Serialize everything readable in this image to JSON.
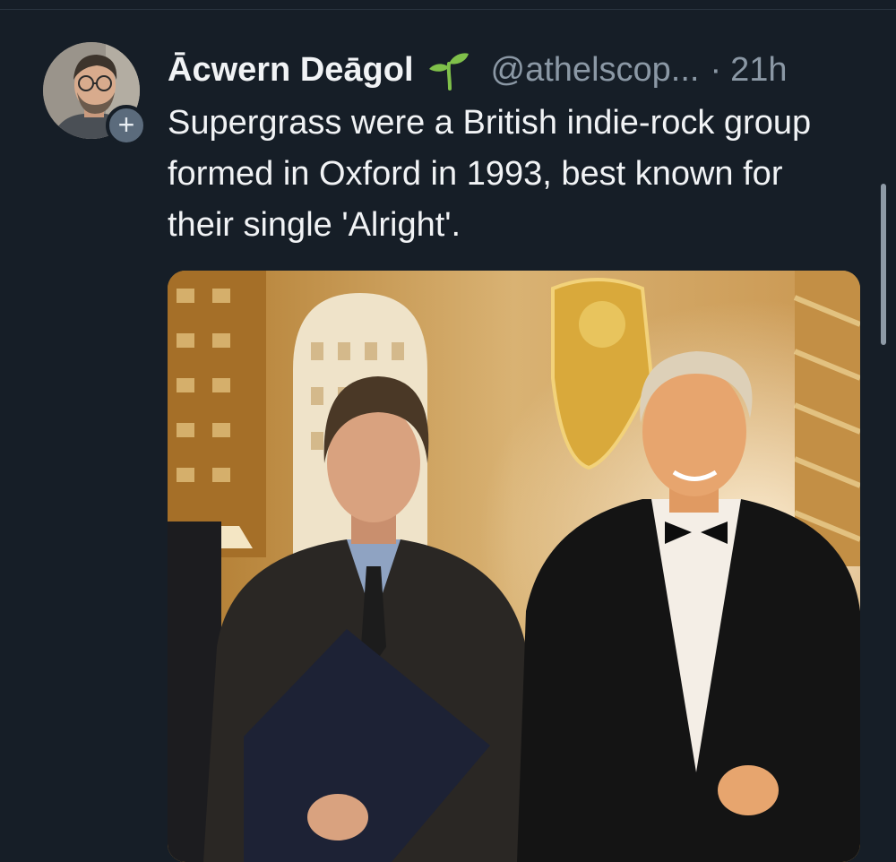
{
  "post": {
    "author": {
      "display_name": "Ācwern Deāgol",
      "handle": "@athelscop...",
      "name_badge_icon": "sprout-icon",
      "follow_icon": "plus-icon",
      "follow_symbol": "+"
    },
    "separator": "·",
    "timestamp": "21h",
    "text": "Supergrass were a British indie-rock group formed in Oxford in 1993, best known for their single 'Alright'.",
    "media": {
      "type": "photo"
    }
  },
  "colors": {
    "background": "#161e27",
    "text_primary": "#f1f3f5",
    "text_secondary": "#8b98a5",
    "sprout_green": "#7fc04a"
  }
}
